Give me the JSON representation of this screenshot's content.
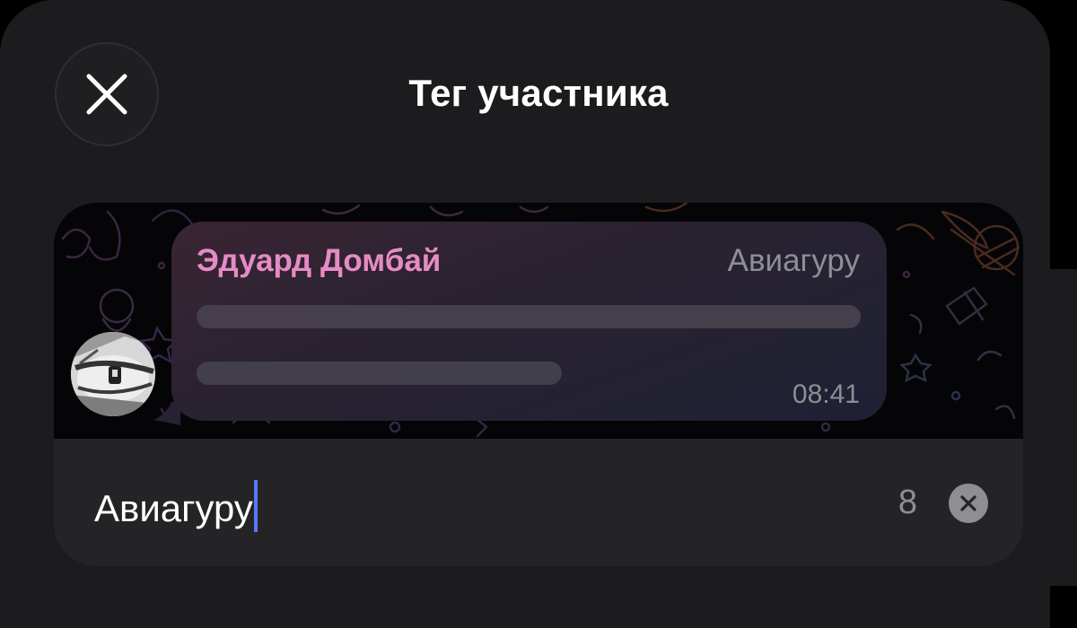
{
  "header": {
    "title": "Тег участника",
    "close_icon": "close-icon"
  },
  "preview": {
    "sender_name": "Эдуард Домбай",
    "member_tag": "Авиагуру",
    "time": "08:41",
    "avatar_icon": "avatar-photo"
  },
  "tag_input": {
    "value": "Авиагуру",
    "remaining_chars": "8",
    "clear_icon": "clear-x-icon"
  },
  "colors": {
    "background": "#1c1c1e",
    "sender_name": "#e58bc6",
    "caret": "#5a78ff",
    "secondary_text": "#8e8e93"
  }
}
